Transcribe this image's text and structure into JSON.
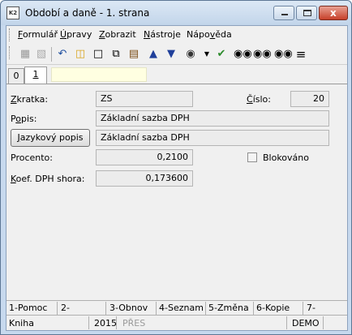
{
  "window": {
    "app_icon_text": "K2",
    "title": "Období a daně - 1. strana",
    "close_glyph": "x"
  },
  "menu": [
    {
      "key": "F",
      "rest": "ormulář"
    },
    {
      "key": "Ú",
      "rest": "pravy"
    },
    {
      "key": "Z",
      "rest": "obrazit"
    },
    {
      "key": "N",
      "rest": "ástroje"
    },
    {
      "key": "Nápo",
      "rest": "věda",
      "underline_after": "v"
    }
  ],
  "toolbar_icons": [
    "save-icon",
    "save-as-icon",
    "undo-icon",
    "open-folder-icon",
    "new-document-icon",
    "copy-icon",
    "book-icon",
    "arrow-up-icon",
    "arrow-down-icon",
    "camera-icon",
    "dropdown-arrow-icon",
    "filter-icon",
    "binoculars-icon",
    "binoculars-next-icon",
    "binoculars-back-icon",
    "list-icon"
  ],
  "tabs": {
    "t0": "0",
    "t1": "1"
  },
  "form": {
    "zkratka_label_u": "Z",
    "zkratka_label_rest": "kratka:",
    "zkratka_value": "ZS",
    "cislo_label_u": "Č",
    "cislo_label_rest": "íslo:",
    "cislo_value": "20",
    "popis_label_pre": "P",
    "popis_label_u": "o",
    "popis_label_rest": "pis:",
    "popis_value": "Základní sazba DPH",
    "jazykovy_button_u": "J",
    "jazykovy_button_rest": "azykový popis",
    "jazykovy_value": "Základní sazba DPH",
    "procento_label": "Procento:",
    "procento_value": "0,2100",
    "blokovano_label": "Blokováno",
    "koef_label_u": "K",
    "koef_label_rest": "oef. DPH shora:",
    "koef_value": "0,173600"
  },
  "fkeys": [
    "1-Pomoc",
    "2-",
    "3-Obnov",
    "4-Seznam",
    "5-Změna",
    "6-Kopie",
    "7-"
  ],
  "status": {
    "book": "Kniha",
    "year": "2015",
    "mode": "PŘES",
    "db": "DEMO"
  }
}
